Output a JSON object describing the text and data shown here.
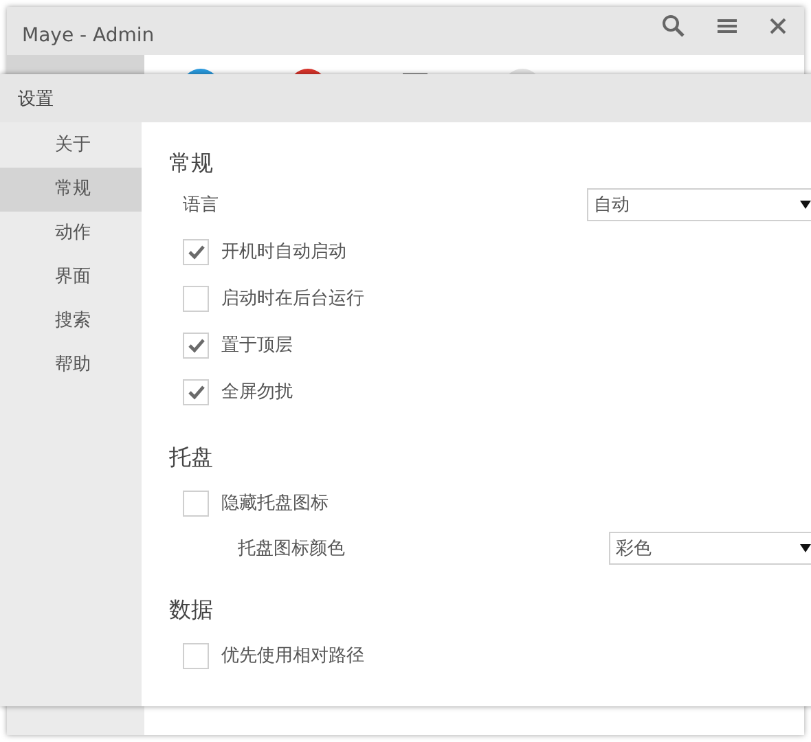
{
  "background_window": {
    "title": "Maye - Admin"
  },
  "settings": {
    "title": "设置",
    "nav": [
      {
        "label": "关于",
        "selected": false
      },
      {
        "label": "常规",
        "selected": true
      },
      {
        "label": "动作",
        "selected": false
      },
      {
        "label": "界面",
        "selected": false
      },
      {
        "label": "搜索",
        "selected": false
      },
      {
        "label": "帮助",
        "selected": false
      }
    ],
    "sections": [
      {
        "title": "常规",
        "items": [
          {
            "kind": "select",
            "label": "语言",
            "value": "自动"
          },
          {
            "kind": "checkbox",
            "label": "开机时自动启动",
            "checked": true
          },
          {
            "kind": "checkbox",
            "label": "启动时在后台运行",
            "checked": false
          },
          {
            "kind": "checkbox",
            "label": "置于顶层",
            "checked": true
          },
          {
            "kind": "checkbox",
            "label": "全屏勿扰",
            "checked": true
          }
        ]
      },
      {
        "title": "托盘",
        "items": [
          {
            "kind": "checkbox",
            "label": "隐藏托盘图标",
            "checked": false
          },
          {
            "kind": "subselect",
            "label": "托盘图标颜色",
            "value": "彩色"
          }
        ]
      },
      {
        "title": "数据",
        "items": [
          {
            "kind": "checkbox",
            "label": "优先使用相对路径",
            "checked": false
          }
        ]
      }
    ]
  }
}
